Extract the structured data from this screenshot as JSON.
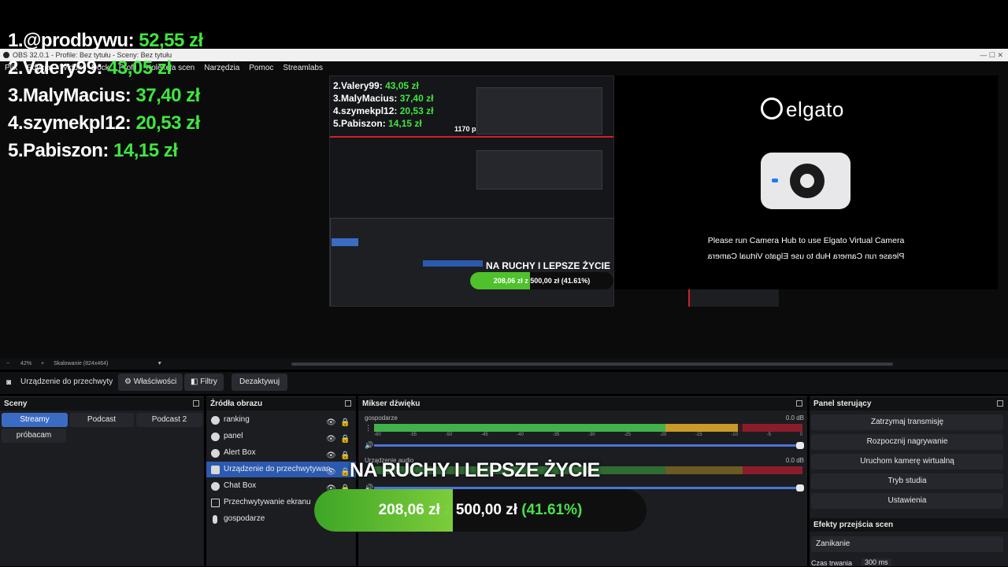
{
  "window": {
    "title": "OBS 32.0.1 - Profile: Bez tytułu - Sceny: Bez tytułu",
    "controls": "—   ☐   ✕"
  },
  "menu": [
    "Plik",
    "Edycja",
    "Widok",
    "Dock",
    "Profil",
    "Kolekcja scen",
    "Narzędzia",
    "Pomoc",
    "Streamlabs"
  ],
  "ranking": [
    {
      "rank": "1.",
      "name": "@prodbywu:",
      "amount": "52,55 zł"
    },
    {
      "rank": "2.",
      "name": "Valery99:",
      "amount": "43,05 zł"
    },
    {
      "rank": "3.",
      "name": "MalyMacius:",
      "amount": "37,40 zł"
    },
    {
      "rank": "4.",
      "name": "szymekpl12:",
      "amount": "20,53 zł"
    },
    {
      "rank": "5.",
      "name": "Pabiszon:",
      "amount": "14,15 zł"
    }
  ],
  "nested": {
    "px_label": "1170 px",
    "banner": "NA RUCHY I LEPSZE ŻYCIE",
    "goal_text": "208,06 zł z 500,00 zł (41.61%)"
  },
  "elgato": {
    "brand": "elgato",
    "message": "Please run Camera Hub to use Elgato Virtual Camera"
  },
  "zoom": {
    "minus": "−",
    "level": "42%",
    "plus": "+",
    "scaling": "Skalowanie (824x464)"
  },
  "source_toolbar": {
    "source": "Urządzenie do przechwyty",
    "properties": "Właściwości",
    "filters": "Filtry",
    "deactivate": "Dezaktywuj"
  },
  "scenes": {
    "title": "Sceny",
    "items": [
      {
        "label": "Streamy",
        "active": true
      },
      {
        "label": "Podcast",
        "active": false
      },
      {
        "label": "Podcast 2",
        "active": false
      },
      {
        "label": "próbacam",
        "active": false
      }
    ]
  },
  "sources": {
    "title": "Źródła obrazu",
    "items": [
      {
        "label": "ranking",
        "active": false
      },
      {
        "label": "panel",
        "active": false
      },
      {
        "label": "Alert Box",
        "active": false
      },
      {
        "label": "Urządzenie do przechwytywan",
        "active": true
      },
      {
        "label": "Chat Box",
        "active": false
      },
      {
        "label": "Przechwytywanie ekranu",
        "active": false
      },
      {
        "label": "gospodarze",
        "active": false
      }
    ]
  },
  "mixer": {
    "title": "Mikser dźwięku",
    "ticks": [
      "-60",
      "-55",
      "-50",
      "-45",
      "-40",
      "-35",
      "-30",
      "-25",
      "-20",
      "-15",
      "-10",
      "-5",
      "0"
    ],
    "channels": [
      {
        "name": "gospodarze",
        "db": "0.0 dB",
        "level": 0.85
      },
      {
        "name": "Urządzenie audio",
        "db": "0.0 dB",
        "level": 0.0
      }
    ]
  },
  "controls": {
    "title": "Panel sterujący",
    "buttons": [
      "Zatrzymaj transmisję",
      "Rozpocznij nagrywanie",
      "Uruchom kamerę wirtualną",
      "Tryb studia",
      "Ustawienia"
    ]
  },
  "transitions": {
    "title": "Efekty przejścia scen",
    "type": "Zanikanie",
    "duration_label": "Czas trwania",
    "duration_value": "300 ms"
  },
  "overlay": {
    "banner": "NA RUCHY I LEPSZE ŻYCIE",
    "goal_current": "208,06 zł",
    "goal_sep": "z",
    "goal_target": "500,00 zł",
    "goal_percent": "(41.61%)",
    "goal_fraction": 0.4161
  },
  "colors": {
    "accent": "#3b6cc4",
    "money_green": "#3fe63f",
    "meter_green": "#41b14a",
    "alert_red": "#d0202a"
  }
}
